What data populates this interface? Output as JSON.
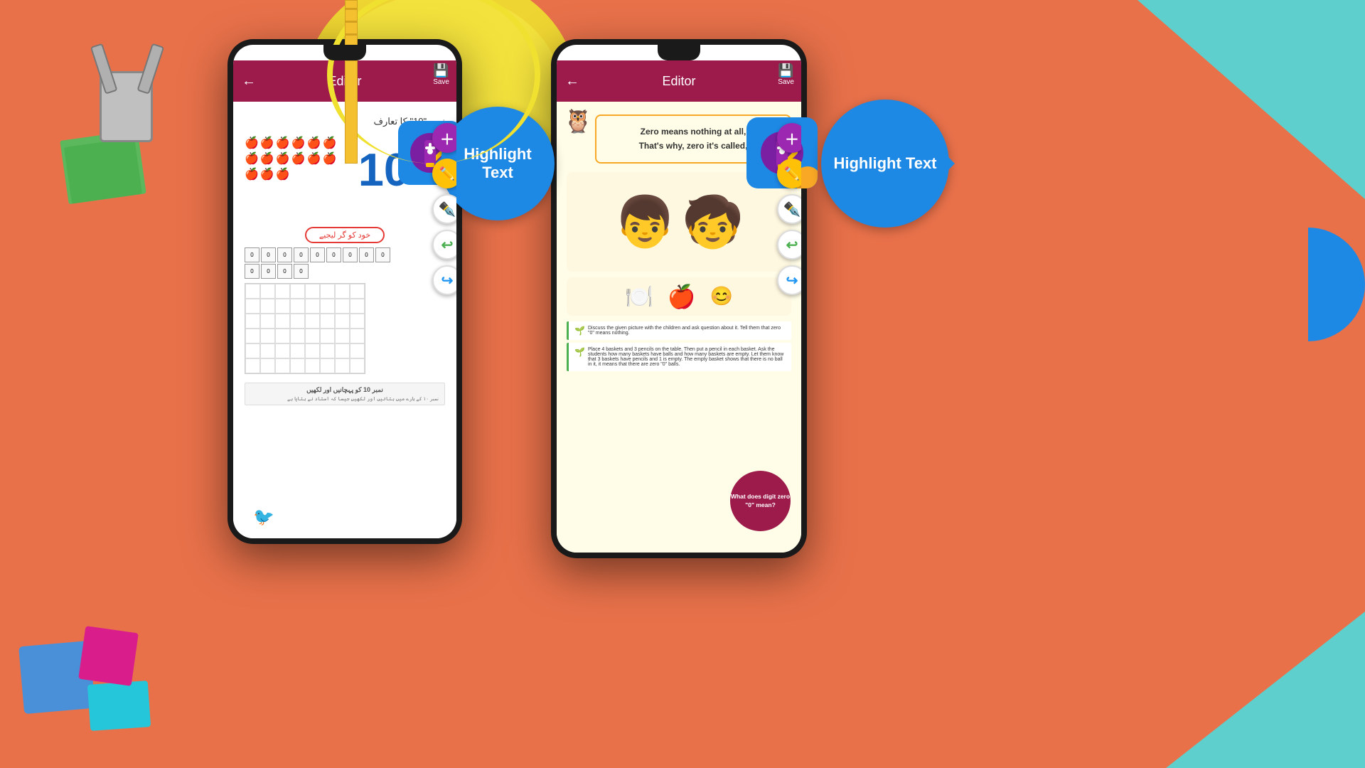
{
  "background": {
    "color": "#E8714A"
  },
  "phone1": {
    "header": {
      "title": "Editor",
      "back_label": "←",
      "save_label": "Save"
    },
    "page": {
      "urdu_title": "نمبر \"10\" کا تعارف",
      "number_display": "10",
      "oval_text": "خود کو گر لیجیے",
      "bottom_note": "نمبر 10 کو پہچانیں اور لکھیں"
    }
  },
  "phone2": {
    "header": {
      "title": "Editor",
      "back_label": "←",
      "save_label": "Save"
    },
    "page": {
      "poem_line1": "Zero means nothing at all,",
      "poem_line2": "That's why, zero it's called,",
      "what_does_label": "What does digit zero \"0\" mean?"
    }
  },
  "highlight_bubble1": {
    "text": "Highlight\nText"
  },
  "highlight_bubble2": {
    "text": "Highlight\nText"
  },
  "tools": {
    "plus_icon": "＋",
    "pencil_icon": "✏",
    "pen_icon": "🖊",
    "undo_icon": "↩",
    "redo_icon": "↪",
    "red_pen_icon": "🖊"
  }
}
